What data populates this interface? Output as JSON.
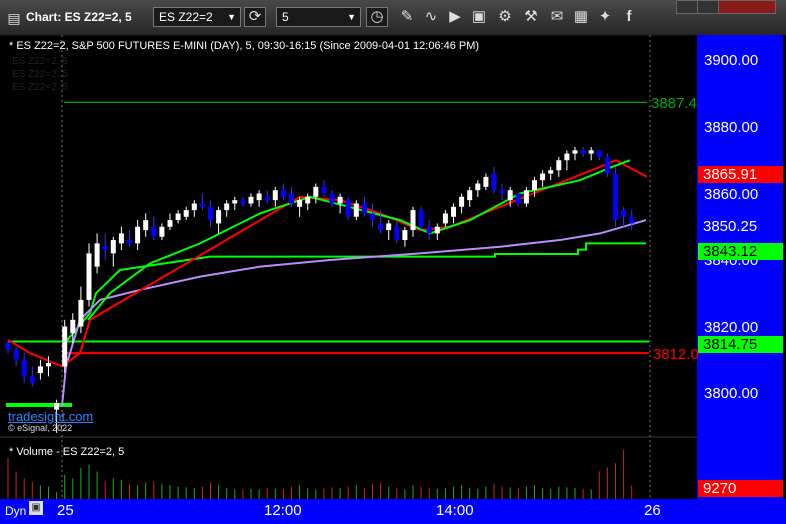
{
  "toolbar": {
    "title": "Chart: ES Z22=2, 5",
    "symbol": "ES Z22=2",
    "interval": "5"
  },
  "chart_header": "* ES Z22=2, S&P 500 FUTURES E-MINI (DAY), 5, 09:30-16:15 (Since 2009-04-01 12:06:46 PM)",
  "legend_ghosts": [
    "ES Z22=2, 5",
    "ES Z22=2, 5",
    "ES Z22=2, 5"
  ],
  "price_axis": {
    "ticks": [
      "3900.00",
      "3880.00",
      "3860.00",
      "3840.00",
      "3820.00",
      "3800.00"
    ],
    "tags": [
      {
        "text": "3887.4",
        "bg": "transparent",
        "fg": "#00aa00",
        "left": true
      },
      {
        "text": "3865.91",
        "bg": "#ff0000",
        "fg": "#ffffff"
      },
      {
        "text": "3850.25",
        "bg": "#0000ff",
        "fg": "#ffffff"
      },
      {
        "text": "3843.12",
        "bg": "#00ff00",
        "fg": "#000000"
      },
      {
        "text": "3814.75",
        "bg": "#00ff00",
        "fg": "#000000"
      },
      {
        "text": "3812.0",
        "bg": "transparent",
        "fg": "#ff0000",
        "left": true
      }
    ]
  },
  "time_axis": [
    "25",
    "12:00",
    "14:00",
    "26"
  ],
  "volume": {
    "title": "* Volume - ES Z22=2, 5",
    "last": "9270"
  },
  "watermark": {
    "logo": "tradesight.com",
    "copyright": "© eSignal, 2022"
  },
  "footer": {
    "mode": "Dyn"
  },
  "colors": {
    "up": "#ffffff",
    "down": "#0000ff",
    "ma_red": "#ff0000",
    "ma_green": "#00ff00",
    "ma_purple": "#b98cff",
    "level_green": "#00ff00",
    "level_red": "#ff0000",
    "top_level": "#00aa00"
  },
  "chart_data": {
    "type": "candlestick",
    "title": "ES Z22=2, S&P 500 FUTURES E-MINI (DAY), 5",
    "ylim": [
      3790,
      3910
    ],
    "x_ticks": [
      "25",
      "12:00",
      "14:00",
      "26"
    ],
    "levels": [
      {
        "value": 3887.4,
        "color": "#00aa00"
      },
      {
        "value": 3814.75,
        "color": "#00ff00"
      },
      {
        "value": 3812.0,
        "color": "#ff0000"
      }
    ],
    "candles": [
      [
        3815,
        3816,
        3812,
        3813
      ],
      [
        3813,
        3814,
        3808,
        3810
      ],
      [
        3810,
        3812,
        3803,
        3805
      ],
      [
        3805,
        3808,
        3802,
        3803
      ],
      [
        3806,
        3810,
        3804,
        3808
      ],
      [
        3808,
        3811,
        3805,
        3809
      ],
      [
        3795,
        3798,
        3788,
        3797
      ],
      [
        3808,
        3822,
        3806,
        3820
      ],
      [
        3818,
        3824,
        3815,
        3822
      ],
      [
        3820,
        3832,
        3818,
        3828
      ],
      [
        3828,
        3845,
        3826,
        3842
      ],
      [
        3838,
        3848,
        3836,
        3845
      ],
      [
        3844,
        3848,
        3840,
        3843
      ],
      [
        3842,
        3847,
        3838,
        3846
      ],
      [
        3845,
        3850,
        3843,
        3848
      ],
      [
        3846,
        3849,
        3844,
        3845
      ],
      [
        3845,
        3852,
        3843,
        3850
      ],
      [
        3849,
        3854,
        3847,
        3852
      ],
      [
        3850,
        3853,
        3846,
        3847
      ],
      [
        3847,
        3851,
        3846,
        3850
      ],
      [
        3850,
        3854,
        3849,
        3852
      ],
      [
        3852,
        3855,
        3851,
        3854
      ],
      [
        3853,
        3856,
        3852,
        3855
      ],
      [
        3855,
        3858,
        3853,
        3857
      ],
      [
        3857,
        3860,
        3855,
        3856
      ],
      [
        3856,
        3858,
        3850,
        3852
      ],
      [
        3851,
        3856,
        3848,
        3855
      ],
      [
        3855,
        3858,
        3853,
        3857
      ],
      [
        3857,
        3859,
        3855,
        3858
      ],
      [
        3858,
        3859,
        3856,
        3857
      ],
      [
        3857,
        3860,
        3856,
        3859
      ],
      [
        3858,
        3861,
        3856,
        3860
      ],
      [
        3859,
        3861,
        3857,
        3858
      ],
      [
        3858,
        3862,
        3856,
        3861
      ],
      [
        3861,
        3863,
        3858,
        3859
      ],
      [
        3860,
        3862,
        3856,
        3857
      ],
      [
        3856,
        3859,
        3853,
        3858
      ],
      [
        3857,
        3860,
        3855,
        3859
      ],
      [
        3859,
        3863,
        3857,
        3862
      ],
      [
        3862,
        3864,
        3859,
        3860
      ],
      [
        3860,
        3861,
        3856,
        3857
      ],
      [
        3857,
        3860,
        3854,
        3859
      ],
      [
        3858,
        3859,
        3852,
        3853
      ],
      [
        3853,
        3858,
        3852,
        3857
      ],
      [
        3857,
        3859,
        3853,
        3854
      ],
      [
        3854,
        3857,
        3850,
        3852
      ],
      [
        3851,
        3855,
        3848,
        3849
      ],
      [
        3849,
        3852,
        3846,
        3851
      ],
      [
        3850,
        3852,
        3845,
        3846
      ],
      [
        3846,
        3850,
        3844,
        3849
      ],
      [
        3849,
        3856,
        3847,
        3855
      ],
      [
        3855,
        3856,
        3849,
        3850
      ],
      [
        3850,
        3852,
        3846,
        3848
      ],
      [
        3848,
        3851,
        3846,
        3850
      ],
      [
        3851,
        3855,
        3850,
        3854
      ],
      [
        3853,
        3857,
        3851,
        3856
      ],
      [
        3856,
        3860,
        3854,
        3859
      ],
      [
        3858,
        3862,
        3856,
        3861
      ],
      [
        3861,
        3864,
        3859,
        3863
      ],
      [
        3862,
        3866,
        3861,
        3865
      ],
      [
        3866,
        3868,
        3860,
        3861
      ],
      [
        3861,
        3863,
        3858,
        3860
      ],
      [
        3858,
        3862,
        3856,
        3861
      ],
      [
        3860,
        3859,
        3856,
        3857
      ],
      [
        3857,
        3862,
        3856,
        3861
      ],
      [
        3861,
        3865,
        3859,
        3864
      ],
      [
        3864,
        3867,
        3862,
        3866
      ],
      [
        3866,
        3868,
        3864,
        3867
      ],
      [
        3867,
        3871,
        3865,
        3870
      ],
      [
        3870,
        3873,
        3867,
        3872
      ],
      [
        3872,
        3874,
        3870,
        3873
      ],
      [
        3873,
        3874,
        3871,
        3872
      ],
      [
        3872,
        3874,
        3870,
        3873
      ],
      [
        3873,
        3873,
        3870,
        3871
      ],
      [
        3871,
        3872,
        3865,
        3866
      ],
      [
        3866,
        3868,
        3850,
        3852
      ],
      [
        3855,
        3856,
        3850,
        3853
      ],
      [
        3853,
        3855,
        3849,
        3851
      ]
    ],
    "volume": [
      60,
      40,
      30,
      25,
      20,
      18,
      10,
      35,
      30,
      45,
      50,
      40,
      25,
      30,
      28,
      22,
      20,
      24,
      26,
      22,
      20,
      18,
      17,
      16,
      18,
      24,
      20,
      16,
      14,
      15,
      15,
      14,
      16,
      15,
      14,
      18,
      20,
      16,
      14,
      15,
      17,
      16,
      18,
      20,
      16,
      22,
      24,
      18,
      16,
      14,
      20,
      18,
      16,
      15,
      16,
      18,
      20,
      16,
      15,
      18,
      22,
      18,
      17,
      16,
      18,
      20,
      16,
      15,
      18,
      17,
      16,
      15,
      14,
      40,
      46,
      52,
      72,
      20
    ]
  }
}
